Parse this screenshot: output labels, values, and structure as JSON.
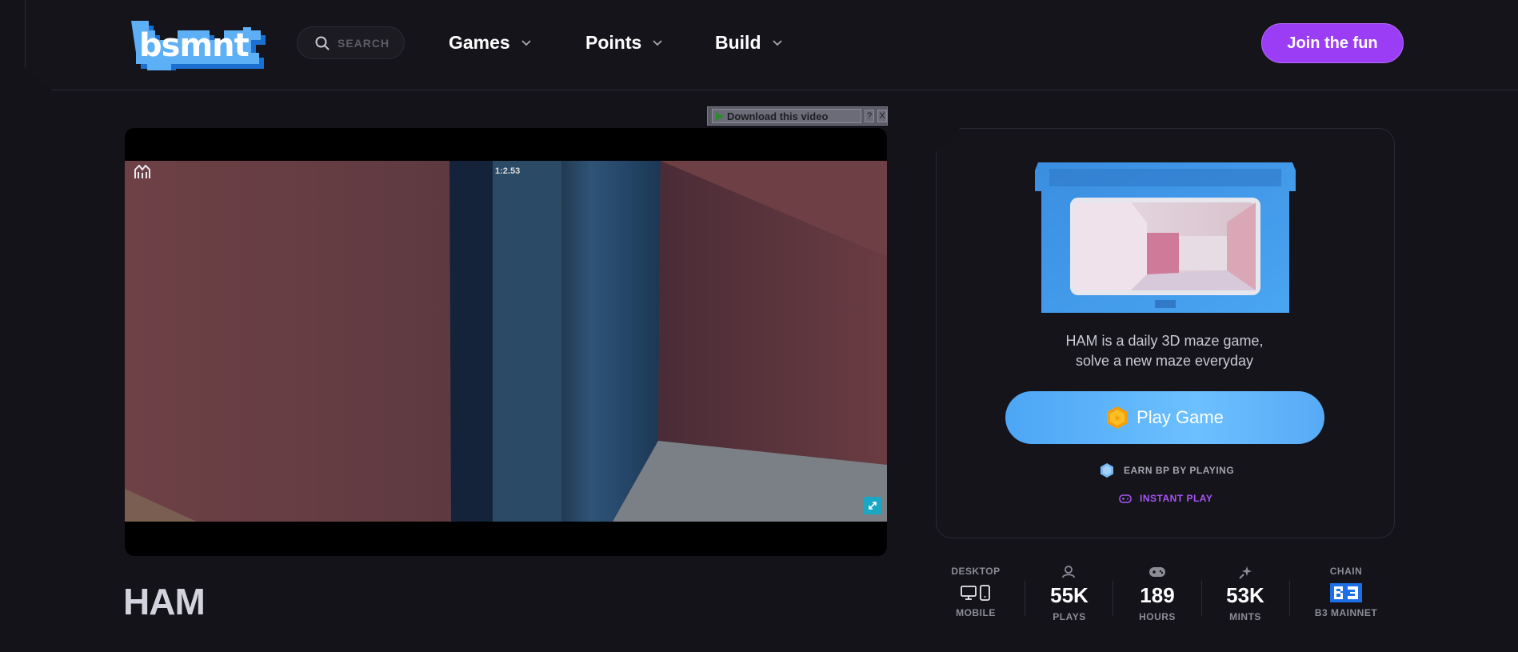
{
  "header": {
    "logo_text": "bsmnt",
    "search_placeholder": "SEARCH",
    "nav": [
      {
        "label": "Games"
      },
      {
        "label": "Points"
      },
      {
        "label": "Build"
      }
    ],
    "join_label": "Join the fun"
  },
  "video": {
    "download_label": "Download this video",
    "help_label": "?",
    "close_label": "X",
    "timer": "1:2.53"
  },
  "game": {
    "title": "HAM",
    "description_line1": "HAM is a daily 3D maze game,",
    "description_line2": "solve a new maze everyday",
    "play_label": "Play Game",
    "earn_label": "EARN BP BY PLAYING",
    "instant_label": "INSTANT PLAY"
  },
  "stats": {
    "platform_top": "DESKTOP",
    "platform_bottom": "MOBILE",
    "plays_value": "55K",
    "plays_label": "PLAYS",
    "hours_value": "189",
    "hours_label": "HOURS",
    "mints_value": "53K",
    "mints_label": "MINTS",
    "chain_top": "CHAIN",
    "chain_bottom": "B3 MAINNET"
  },
  "colors": {
    "accent_purple": "#9a3df4",
    "play_blue": "#5aaef7",
    "background": "#14131a"
  }
}
